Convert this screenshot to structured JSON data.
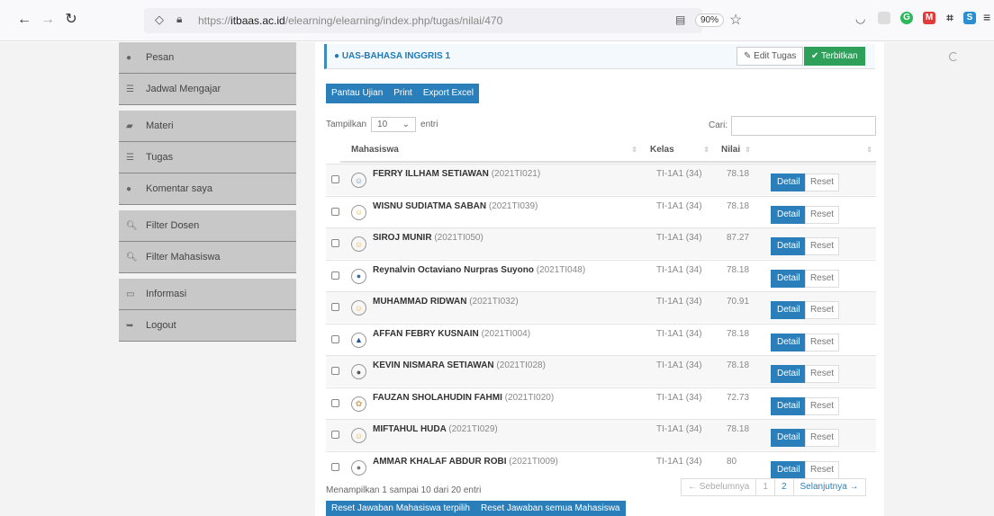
{
  "browser": {
    "url_prefix": "https://",
    "url_domain": "itbaas.ac.id",
    "url_path": "/elearning/elearning/index.php/tugas/nilai/470",
    "zoom": "90%"
  },
  "sidebar": {
    "items": [
      {
        "label": "Pesan",
        "icon": "chat-icon"
      },
      {
        "label": "Jadwal Mengajar",
        "icon": "list-icon"
      },
      {
        "label": "Materi",
        "icon": "book-icon"
      },
      {
        "label": "Tugas",
        "icon": "list-icon"
      },
      {
        "label": "Komentar saya",
        "icon": "chat-icon"
      },
      {
        "label": "Filter Dosen",
        "icon": "search-icon"
      },
      {
        "label": "Filter Mahasiswa",
        "icon": "search-icon"
      },
      {
        "label": "Informasi",
        "icon": "info-icon"
      },
      {
        "label": "Logout",
        "icon": "logout-icon"
      }
    ]
  },
  "task": {
    "title": "UAS-BAHASA INGGRIS 1",
    "edit_label": "Edit Tugas",
    "publish_label": "Terbitkan"
  },
  "actions": {
    "monitor": "Pantau Ujian",
    "print": "Print",
    "export": "Export Excel"
  },
  "table_controls": {
    "show_label": "Tampilkan",
    "page_size": "10",
    "entries_label": "entri",
    "search_label": "Cari:"
  },
  "columns": {
    "student": "Mahasiswa",
    "class": "Kelas",
    "grade": "Nilai"
  },
  "rows": [
    {
      "name": "FERRY ILLHAM SETIAWAN",
      "nim": "(2021TI021)",
      "kelas": "TI-1A1 (34)",
      "nilai": "78.18"
    },
    {
      "name": "WISNU SUDIATMA SABAN",
      "nim": "(2021TI039)",
      "kelas": "TI-1A1 (34)",
      "nilai": "78.18"
    },
    {
      "name": "SIROJ MUNIR",
      "nim": "(2021TI050)",
      "kelas": "TI-1A1 (34)",
      "nilai": "87.27"
    },
    {
      "name": "Reynalvin Octaviano Nurpras Suyono",
      "nim": "(2021TI048)",
      "kelas": "TI-1A1 (34)",
      "nilai": "78.18"
    },
    {
      "name": "MUHAMMAD RIDWAN",
      "nim": "(2021TI032)",
      "kelas": "TI-1A1 (34)",
      "nilai": "70.91"
    },
    {
      "name": "AFFAN FEBRY KUSNAIN",
      "nim": "(2021TI004)",
      "kelas": "TI-1A1 (34)",
      "nilai": "78.18"
    },
    {
      "name": "KEVIN NISMARA SETIAWAN",
      "nim": "(2021TI028)",
      "kelas": "TI-1A1 (34)",
      "nilai": "78.18"
    },
    {
      "name": "FAUZAN SHOLAHUDIN FAHMI",
      "nim": "(2021TI020)",
      "kelas": "TI-1A1 (34)",
      "nilai": "72.73"
    },
    {
      "name": "MIFTAHUL HUDA",
      "nim": "(2021TI029)",
      "kelas": "TI-1A1 (34)",
      "nilai": "78.18"
    },
    {
      "name": "AMMAR KHALAF ABDUR ROBI",
      "nim": "(2021TI009)",
      "kelas": "TI-1A1 (34)",
      "nilai": "80"
    }
  ],
  "row_buttons": {
    "detail": "Detail",
    "reset": "Reset"
  },
  "footer": {
    "info": "Menampilkan 1 sampai 10 dari 20 entri",
    "prev": "← Sebelumnya",
    "page1": "1",
    "page2": "2",
    "next": "Selanjutnya →",
    "reset_selected": "Reset Jawaban Mahasiswa terpilih",
    "reset_all": "Reset Jawaban semua Mahasiswa"
  },
  "colors": {
    "primary": "#2a7fba",
    "success": "#2ea05a",
    "sidebar": "#c8c8c8"
  }
}
